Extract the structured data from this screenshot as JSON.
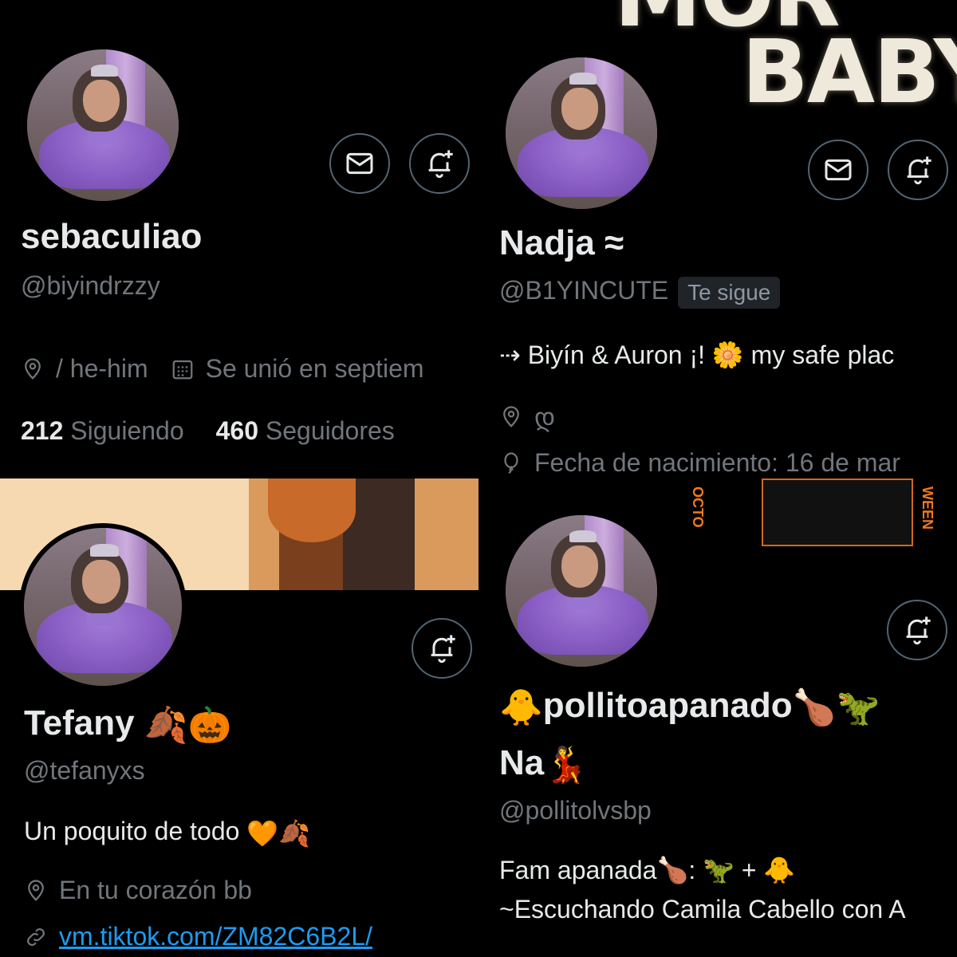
{
  "profiles": [
    {
      "name": "sebaculiao",
      "handle": "@biyindrzzy",
      "location": "/ he-him",
      "joined": "Se unió en septiem",
      "following_count": "212",
      "following_label": "Siguiendo",
      "followers_count": "460",
      "followers_label": "Seguidores"
    },
    {
      "name": "Nadja ≈",
      "handle": "@B1YINCUTE",
      "follows_you": "Te sigue",
      "bio": "⇢ Biyín & Auron ¡! 🌼  my safe plac",
      "location": "დ",
      "birthday": "Fecha de nacimiento: 16 de mar",
      "banner_text": "BABY"
    },
    {
      "name": "Tefany",
      "name_emoji": "🍂🎃",
      "handle": "@tefanyxs",
      "bio": "Un poquito de todo",
      "bio_emoji": "🧡🍂",
      "location": "En tu corazón bb",
      "link": "vm.tiktok.com/ZM82C6B2L/"
    },
    {
      "name_line1_emoji": "🐥",
      "name_line1": "pollitoapanado",
      "name_line1_tail": "🍗🦖",
      "name_line2": "Na",
      "name_line2_emoji": "💃",
      "handle": "@pollitolvsbp",
      "bio_line1": "Fam apanada🍗: 🦖 + 🐥",
      "bio_line2": "~Escuchando Camila Cabello con A",
      "banner_left": "OCTO",
      "banner_right": "WEEN"
    }
  ],
  "icons": {
    "message": "envelope-icon",
    "notify": "bell-plus-icon",
    "location": "map-pin-icon",
    "calendar": "calendar-icon",
    "balloon": "balloon-icon",
    "link": "link-icon"
  },
  "colors": {
    "background": "#000000",
    "primary_text": "#e7e9ea",
    "secondary_text": "#71767b",
    "link": "#1d9bf0",
    "button_border": "#536471"
  }
}
